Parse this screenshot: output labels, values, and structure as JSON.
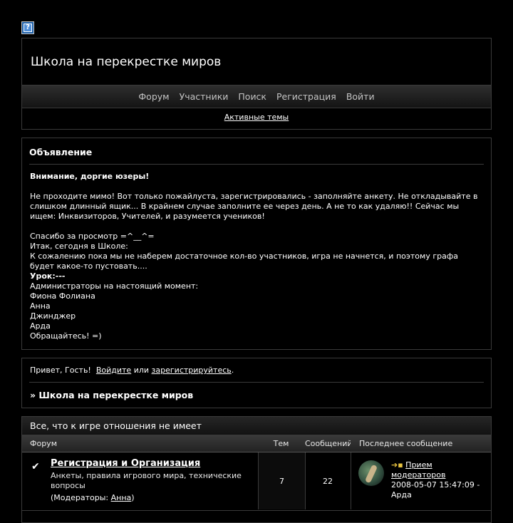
{
  "header": {
    "site_title": "Школа на перекрестке миров",
    "nav": [
      "Форум",
      "Участники",
      "Поиск",
      "Регистрация",
      "Войти"
    ],
    "active_topics": "Активные темы"
  },
  "announcement": {
    "title": "Объявление",
    "greeting": "Внимание, доргие юзеры!",
    "para1": "Не проходите мимо! Вот только пожайлуста, зарегистрировались - заполняйте анкету. Не откладывайте в слишком длинный ящик... В крайнем случае заполните ее через день. А не то как удаляю!! Сейчас мы ищем: Инквизиторов, Учителей, и разумеется учеников!",
    "thanks": "Спасибо за просмотр =^__^=",
    "today": "Итак, сегодня в Школе:",
    "sorry": "К сожалению пока мы не наберем достаточное кол-во участников, игра не начнется, и поэтому графа будет какое-то пустовать....",
    "lesson": "Урок:---",
    "admins_label": "Администраторы на настоящий момент:",
    "admins": [
      "Фиона Фолиана",
      "Анна",
      "Джинджер",
      "Арда"
    ],
    "contact": "Обращайтесь! =)"
  },
  "welcome": {
    "hello": "Привет, Гость!",
    "login": "Войдите",
    "or": "или",
    "register": "зарегистрируйтесь",
    "dot": ".",
    "crumb": "» Школа на перекрестке миров"
  },
  "forum_table": {
    "category": "Все, что к игре отношения не имеет",
    "columns": {
      "forum": "Форум",
      "topics": "Тем",
      "posts": "Сообщений",
      "last": "Последнее сообщение"
    },
    "rows": [
      {
        "title": "Регистрация и Организация",
        "description": "Анкеты, правила игрового мира, технические вопросы",
        "mods_prefix": "(Модераторы:",
        "mod": "Анна",
        "mods_suffix": ")",
        "topics": "7",
        "posts": "22",
        "last_title": "Прием модераторов",
        "last_date": "2008-05-07 15:47:09 -",
        "last_author": "Арда"
      }
    ]
  }
}
